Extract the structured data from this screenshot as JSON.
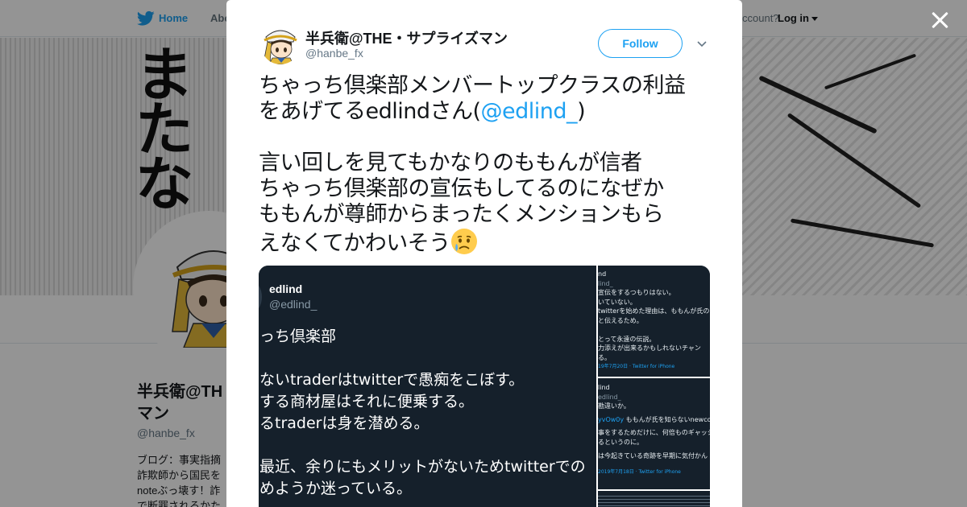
{
  "background": {
    "nav": {
      "home": "Home",
      "about": "Abo",
      "account_prompt": "ccount?",
      "login": "Log in"
    },
    "profile": {
      "name": "半兵衛@TH… マン",
      "name_line1": "半兵衛@TH",
      "name_line2": "マン",
      "handle": "@hanbe_fx",
      "bio_lines": [
        "ブログ：事実指摘",
        "詐欺師から国民を",
        "noteぶっ壊す！詐",
        "で断罪されるかた"
      ]
    }
  },
  "modal": {
    "author": {
      "name": "半兵衛@THE・サプライズマン",
      "handle": "@hanbe_fx"
    },
    "follow_label": "Follow",
    "tweet": {
      "line1": "ちゃっち倶楽部メンバートップクラスの利益",
      "line2_pre": "をあげてるedlindさん(",
      "mention": "@edlind_",
      "line2_post": ")",
      "line3": "言い回しを見てもかなりのももんが信者",
      "line4": "ちゃっち倶楽部の宣伝もしてるのになぜか",
      "line5": "ももんが尊師からまったくメンションもら",
      "line6": "えなくてかわいそう"
    },
    "media": {
      "main": {
        "name": "edlind",
        "handle": "@edlind_",
        "lines": [
          "っち倶楽部",
          "",
          "ないtraderはtwitterで愚痴をこぼす。",
          "する商材屋はそれに便乗する。",
          "るtraderは身を潜める。",
          "",
          "最近、余りにもメリットがないためtwitterでの",
          "めようか迷っている。"
        ]
      },
      "side_top": {
        "lines": [
          "nd",
          "lind_",
          "宣伝をするつもりはない。",
          "いていない。",
          "twitterを始めた理由は、ももんが氏の",
          "と伝えるため。",
          "",
          "とって永遠の伝説。",
          "力添えが出来るかもしれないチャン",
          "る。"
        ],
        "meta": "19年7月20日 · Twitter for iPhone"
      },
      "side_mid": {
        "lines": [
          "lind",
          "edlind_",
          "勘違いか。"
        ],
        "reply_hl": "yvOw0y",
        "reply_rest": " ももんが氏を知らないnewcome",
        "body": [
          "事をするためだけに、何倍ものギャッシ",
          "るというのに。",
          "",
          "は今起きている奇跡を早期に気付かん"
        ],
        "meta": "2019年7月18日 · Twitter for iPhone"
      }
    }
  },
  "icons": {
    "logo": "twitter-bird-icon",
    "close": "close-icon",
    "chevron": "chevron-down-icon",
    "emoji": "crying-face-emoji"
  },
  "colors": {
    "brand": "#1da1f2",
    "text": "#14171a",
    "muted": "#657786",
    "media_bg": "#15202b"
  }
}
